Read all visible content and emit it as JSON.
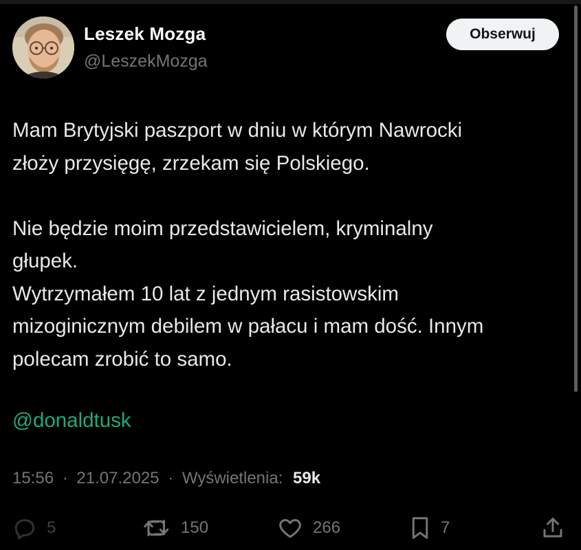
{
  "author": {
    "display_name": "Leszek Mozga",
    "handle": "@LeszekMozga",
    "avatar": "profile-photo-man-round-glasses-beard"
  },
  "follow_button": {
    "label": "Obserwuj"
  },
  "tweet": {
    "paragraph_1": "Mam Brytyjski paszport w dniu w którym Nawrocki\nzłoży przysięgę, zrzekam się Polskiego.",
    "paragraph_2": "Nie będzie moim przedstawicielem, kryminalny\ngłupek.\nWytrzymałem 10 lat z jednym rasistowskim\nmizoginicznym debilem w pałacu i mam dość. Innym\npolecam zrobić to samo.",
    "mention": "@donaldtusk"
  },
  "meta": {
    "time": "15:56",
    "separator": "·",
    "date": "21.07.2025",
    "views_label": "Wyświetlenia:",
    "views_count": "59k"
  },
  "actions": {
    "replies": {
      "icon": "reply-bubble-icon",
      "count": "5"
    },
    "reposts": {
      "icon": "repost-icon",
      "count": "150"
    },
    "likes": {
      "icon": "heart-icon",
      "count": "266"
    },
    "bookmarks": {
      "icon": "bookmark-icon",
      "count": "7"
    },
    "share": {
      "icon": "share-icon"
    }
  },
  "colors": {
    "background": "#000000",
    "text": "#e7e9ea",
    "secondary_text": "#71767b",
    "mention": "#1a9e8c",
    "follow_button_bg": "#eff3f4",
    "follow_button_text": "#0f1419"
  }
}
